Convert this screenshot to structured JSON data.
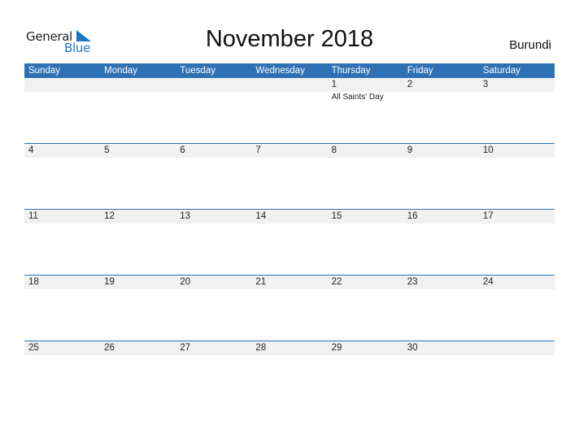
{
  "logo": {
    "line1": "General",
    "line2": "Blue",
    "brand_color": "#1f75c6"
  },
  "title": "November 2018",
  "country": "Burundi",
  "accent_color": "#2e70b4",
  "weekdays": [
    "Sunday",
    "Monday",
    "Tuesday",
    "Wednesday",
    "Thursday",
    "Friday",
    "Saturday"
  ],
  "weeks": [
    {
      "days": [
        "",
        "",
        "",
        "",
        "1",
        "2",
        "3"
      ],
      "events": [
        "",
        "",
        "",
        "",
        "All Saints' Day",
        "",
        ""
      ]
    },
    {
      "days": [
        "4",
        "5",
        "6",
        "7",
        "8",
        "9",
        "10"
      ],
      "events": [
        "",
        "",
        "",
        "",
        "",
        "",
        ""
      ]
    },
    {
      "days": [
        "11",
        "12",
        "13",
        "14",
        "15",
        "16",
        "17"
      ],
      "events": [
        "",
        "",
        "",
        "",
        "",
        "",
        ""
      ]
    },
    {
      "days": [
        "18",
        "19",
        "20",
        "21",
        "22",
        "23",
        "24"
      ],
      "events": [
        "",
        "",
        "",
        "",
        "",
        "",
        ""
      ]
    },
    {
      "days": [
        "25",
        "26",
        "27",
        "28",
        "29",
        "30",
        ""
      ],
      "events": [
        "",
        "",
        "",
        "",
        "",
        "",
        ""
      ]
    }
  ]
}
